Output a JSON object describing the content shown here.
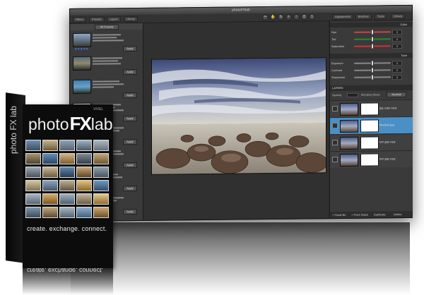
{
  "app": {
    "title": "photoFXlab",
    "toolbar_tabs": [
      "Filters",
      "Presets",
      "Layers",
      "Library"
    ],
    "toolbar_right_tabs": [
      "Adjustments",
      "Brushes",
      "Tools",
      "Library"
    ],
    "colors": {
      "accent": "#4a90c6",
      "panel": "#3a3a3a",
      "canvas": "#303030"
    }
  },
  "left_panel": {
    "header_button": "All Presets",
    "items": [
      {
        "name": "Preset 1",
        "rating": "★★★★★",
        "apply": "Apply"
      },
      {
        "name": "Preset 2",
        "rating": "★★★★★",
        "apply": "Apply"
      },
      {
        "name": "Preset 3",
        "rating": "★★★★★",
        "apply": "Apply"
      },
      {
        "name": "Preset 4",
        "rating": "★★★★★",
        "apply": "Apply"
      },
      {
        "name": "Preset 5",
        "rating": "★★★★★",
        "apply": "Apply"
      },
      {
        "name": "Preset 6",
        "rating": "★★★★★",
        "apply": "Apply"
      },
      {
        "name": "Preset 7",
        "rating": "★★★★★",
        "apply": "Apply"
      },
      {
        "name": "Preset 8",
        "rating": "★★★★★",
        "apply": "Apply"
      }
    ]
  },
  "right_panel": {
    "color_section": "Color",
    "color_sliders": [
      {
        "label": "Hue",
        "value": "0",
        "level": 0.5,
        "track": "#c44"
      },
      {
        "label": "Tint",
        "value": "0",
        "level": 0.5,
        "track": "#2a8a2a"
      },
      {
        "label": "Saturation",
        "value": "0",
        "level": 0.5,
        "track": "#c33"
      }
    ],
    "tone_section": "Tone",
    "tone_sliders": [
      {
        "label": "Exposure",
        "value": "0",
        "level": 0.5,
        "track": "#888"
      },
      {
        "label": "Contrast",
        "value": "0",
        "level": 0.5,
        "track": "#888"
      },
      {
        "label": "Sharpness",
        "value": "0",
        "level": 0.5,
        "track": "#888"
      }
    ],
    "layers_heading": "LAYERS",
    "opacity_label": "Opacity",
    "blend_label": "Blending Mode",
    "blend_value": "Normal",
    "layers": [
      {
        "name": "jpg copy copy",
        "selected": false
      },
      {
        "name": "Medium.jpg",
        "selected": true
      },
      {
        "name": "tom.jpg copy",
        "selected": false
      },
      {
        "name": "tom.jpg copy",
        "selected": false
      }
    ],
    "footer_buttons": [
      "+ Fixed file",
      "+ From Stack",
      "Duplicate",
      "Delete"
    ]
  },
  "box": {
    "brand_pre": "photo",
    "brand_fx": "FX",
    "brand_post": "lab",
    "tagline": "create. exchange. connect.",
    "side_text": "photo FX lab",
    "vendor": "VIVEL"
  }
}
